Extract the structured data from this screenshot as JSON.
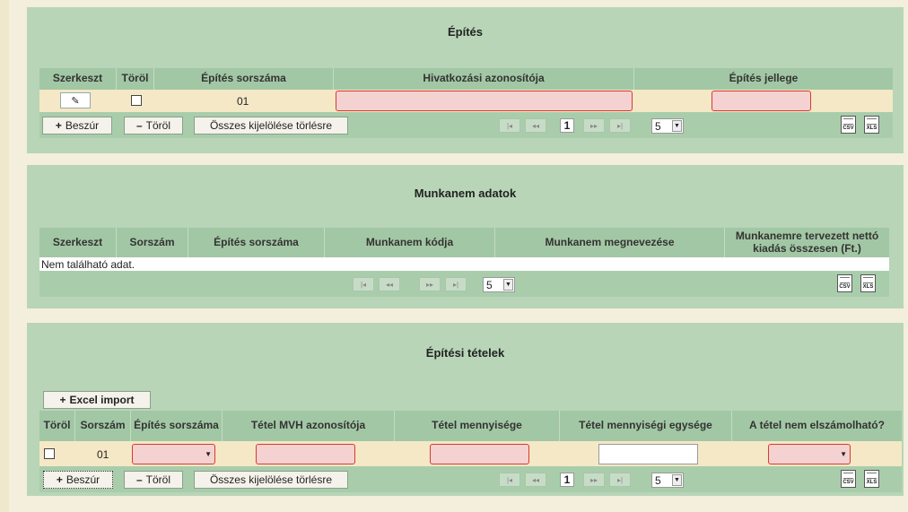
{
  "panel1": {
    "title": "Építés",
    "columns": [
      "Szerkeszt",
      "Töröl",
      "Építés sorszáma",
      "Hivatkozási azonosítója",
      "Építés jellege"
    ],
    "row": {
      "sorszam": "01"
    },
    "buttons": {
      "insert": "Beszúr",
      "delete": "Töröl",
      "select_all": "Összes kijelölése törlésre"
    },
    "pager": {
      "page": "1",
      "page_size": "5"
    }
  },
  "panel2": {
    "title": "Munkanem adatok",
    "columns": [
      "Szerkeszt",
      "Sorszám",
      "Építés sorszáma",
      "Munkanem kódja",
      "Munkanem megnevezése",
      "Munkanemre tervezett nettó kiadás összesen (Ft.)"
    ],
    "empty_text": "Nem található adat.",
    "pager": {
      "page_size": "5"
    }
  },
  "panel3": {
    "title": "Építési tételek",
    "excel_button": "Excel import",
    "columns": [
      "Töröl",
      "Sorszám",
      "Építés sorszáma",
      "Tétel MVH azonosítója",
      "Tétel mennyisége",
      "Tétel mennyiségi egysége",
      "A tétel nem elszámolható?"
    ],
    "row": {
      "sorszam": "01"
    },
    "buttons": {
      "insert": "Beszúr",
      "delete": "Töröl",
      "select_all": "Összes kijelölése törlésre"
    },
    "pager": {
      "page": "1",
      "page_size": "5"
    }
  },
  "icons": {
    "first": "first-page-icon",
    "prev": "prev-page-icon",
    "next": "next-page-icon",
    "last": "last-page-icon",
    "csv_label": "CSV",
    "xls_label": "XLS"
  }
}
